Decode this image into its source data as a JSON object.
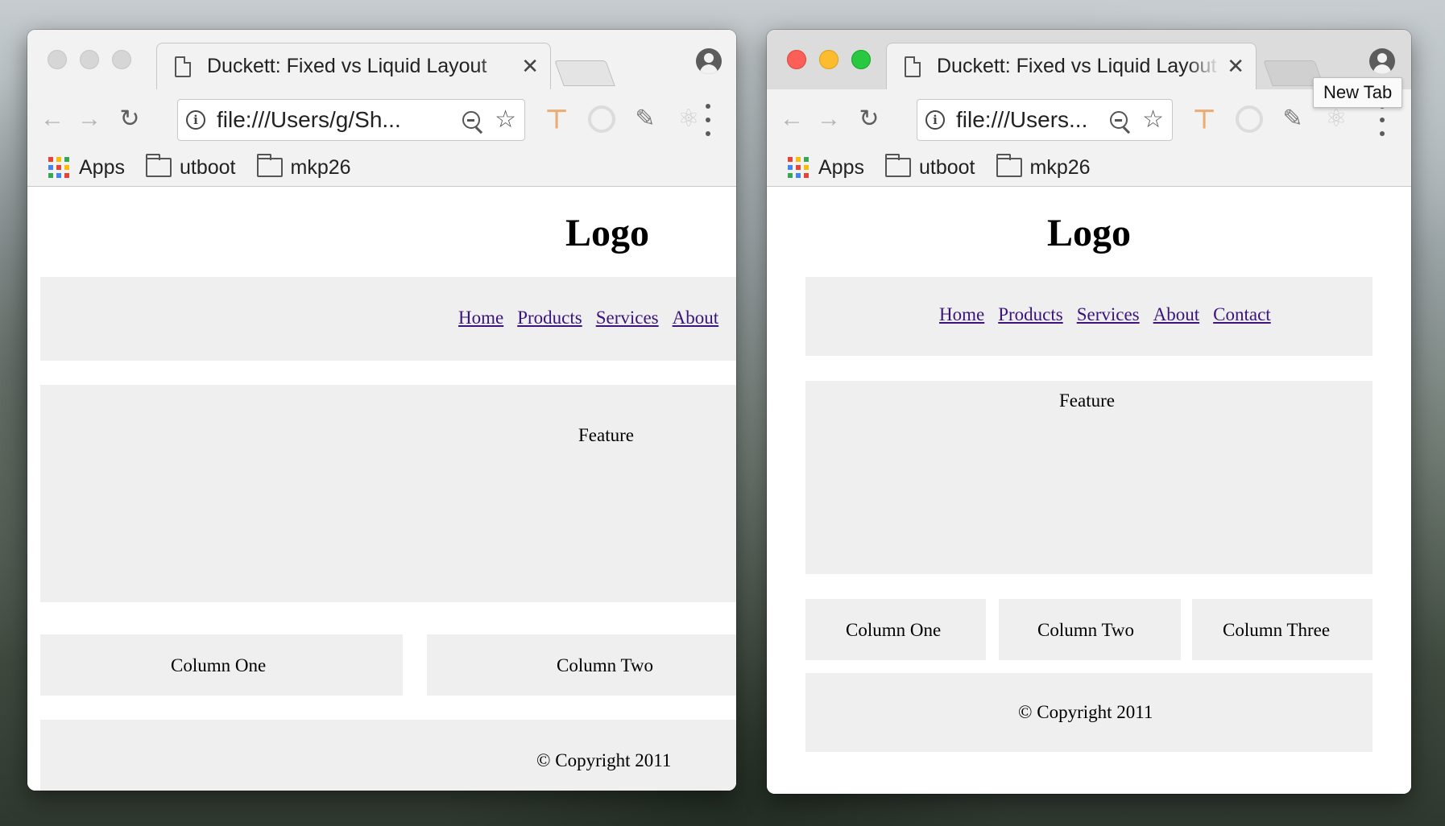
{
  "left_window": {
    "tab_title": "Duckett: Fixed vs Liquid Layout",
    "url": "file:///Users/g/Sh...",
    "bookmarks": [
      "Apps",
      "utboot",
      "mkp26"
    ],
    "page": {
      "logo": "Logo",
      "nav": [
        "Home",
        "Products",
        "Services",
        "About"
      ],
      "feature": "Feature",
      "columns": [
        "Column One",
        "Column Two"
      ],
      "footer": "© Copyright 2011"
    }
  },
  "right_window": {
    "tab_title": "Duckett: Fixed vs Liquid Layout",
    "url": "file:///Users...",
    "tooltip": "New Tab",
    "bookmarks": [
      "Apps",
      "utboot",
      "mkp26"
    ],
    "page": {
      "logo": "Logo",
      "nav": [
        "Home",
        "Products",
        "Services",
        "About",
        "Contact"
      ],
      "feature": "Feature",
      "columns": [
        "Column One",
        "Column Two",
        "Column Three"
      ],
      "footer": "© Copyright 2011"
    }
  },
  "icons": {
    "page": "document-icon",
    "close": "close-icon",
    "back": "back-arrow-icon",
    "forward": "forward-arrow-icon",
    "reload": "reload-icon",
    "info": "info-icon",
    "zoom": "zoom-out-icon",
    "star": "star-icon",
    "menu": "three-dot-menu-icon"
  },
  "colors": {
    "link": "#3a147a",
    "block_bg": "#efefef",
    "close_btn": "#fc5f57",
    "min_btn": "#fdbc2e",
    "max_btn": "#28c840"
  }
}
